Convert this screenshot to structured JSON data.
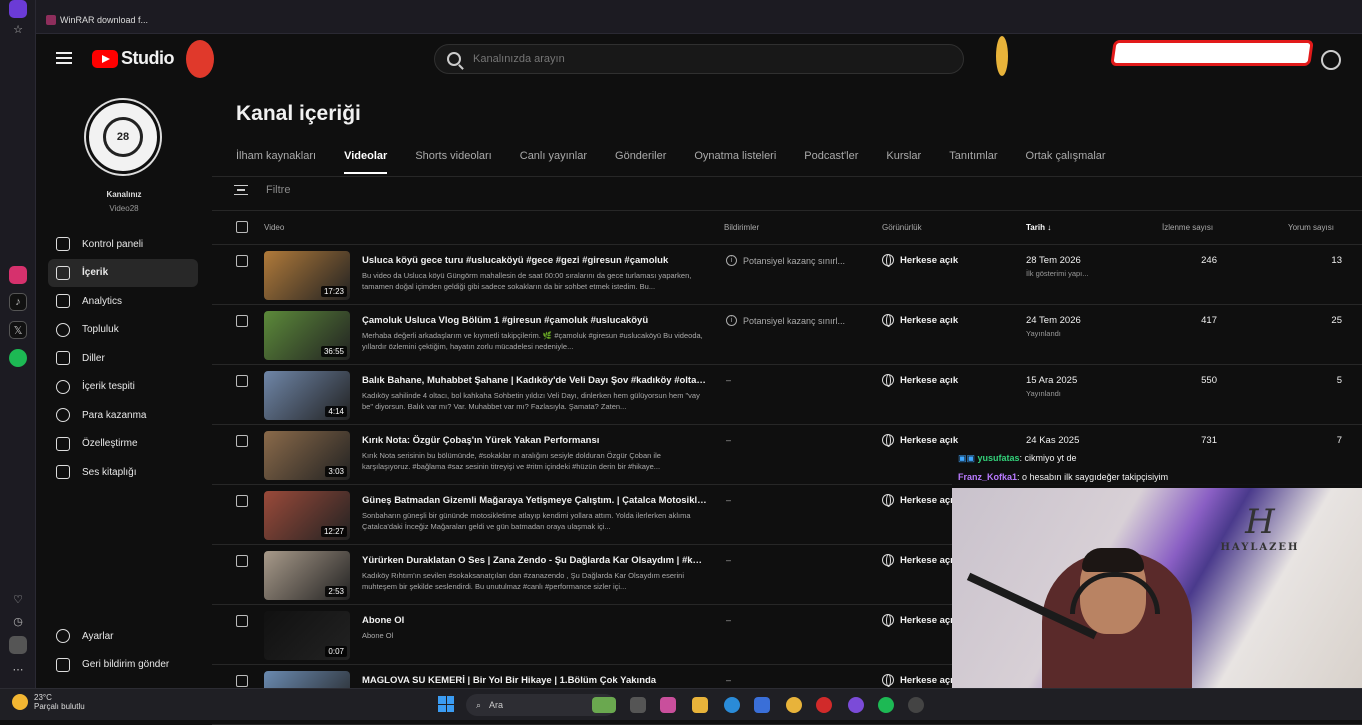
{
  "browser": {
    "tab_title": "WinRAR download f..."
  },
  "header": {
    "logo_text": "Studio",
    "search_placeholder": "Kanalınızda arayın"
  },
  "channel": {
    "name": "Kanalınız",
    "handle": "Video28",
    "avatar_text": "28"
  },
  "sidebar": {
    "items": [
      {
        "label": "Kontrol paneli",
        "icon": "dashboard-icon",
        "active": false
      },
      {
        "label": "İçerik",
        "icon": "content-icon",
        "active": true
      },
      {
        "label": "Analytics",
        "icon": "analytics-icon",
        "active": false
      },
      {
        "label": "Topluluk",
        "icon": "community-icon",
        "active": false
      },
      {
        "label": "Diller",
        "icon": "subtitles-icon",
        "active": false
      },
      {
        "label": "İçerik tespiti",
        "icon": "copyright-icon",
        "active": false
      },
      {
        "label": "Para kazanma",
        "icon": "monetization-icon",
        "active": false
      },
      {
        "label": "Özelleştirme",
        "icon": "customization-icon",
        "active": false
      },
      {
        "label": "Ses kitaplığı",
        "icon": "audio-library-icon",
        "active": false
      }
    ],
    "bottom": [
      {
        "label": "Ayarlar",
        "icon": "gear-icon"
      },
      {
        "label": "Geri bildirim gönder",
        "icon": "feedback-icon"
      }
    ]
  },
  "main": {
    "title": "Kanal içeriği",
    "tabs": [
      "İlham kaynakları",
      "Videolar",
      "Shorts videoları",
      "Canlı yayınlar",
      "Gönderiler",
      "Oynatma listeleri",
      "Podcast'ler",
      "Kurslar",
      "Tanıtımlar",
      "Ortak çalışmalar"
    ],
    "active_tab": "Videolar",
    "filter_placeholder": "Filtre",
    "columns": {
      "video": "Video",
      "restrictions": "Bildirimler",
      "visibility": "Görünürlük",
      "date": "Tarih",
      "views": "İzlenme sayısı",
      "comments": "Yorum sayısı"
    },
    "rows": [
      {
        "title": "Usluca köyü gece turu #uslucaköyü #gece #gezi #giresun #çamoluk",
        "desc": "Bu video da Usluca köyü Güngörm mahallesin de saat 00:00 sıralarını da gece turlaması yaparken, tamamen doğal içimden geldiği gibi sadece sokakların da bir sohbet etmek istedim. Bu...",
        "duration": "17:23",
        "restriction": "Potansiyel kazanç sınırl...",
        "visibility": "Herkese açık",
        "date": "28 Tem 2026",
        "date_sub": "İlk gösterimi yapı...",
        "views": "246",
        "comments": "13",
        "thumb": "#b07a3a"
      },
      {
        "title": "Çamoluk Usluca Vlog Bölüm 1 #giresun #çamoluk #uslucaköyü",
        "desc": "Merhaba değerli arkadaşlarım ve kıymetli takipçilerim. 🌿 #çamoluk #giresun #uslucaköyü Bu videoda, yıllardır özlemini çektiğim, hayatın zorlu mücadelesi nedeniyle...",
        "duration": "36:55",
        "restriction": "Potansiyel kazanç sınırl...",
        "visibility": "Herkese açık",
        "date": "24 Tem 2026",
        "date_sub": "Yayınlandı",
        "views": "417",
        "comments": "25",
        "thumb": "#5c8a3a"
      },
      {
        "title": "Balık Bahane, Muhabbet Şahane | Kadıköy'de Veli Dayı Şov #kadıköy #oltabal...",
        "desc": "Kadıköy sahilinde 4 oltacı, bol kahkaha Sohbetin yıldızı Veli Dayı, dinlerken hem gülüyorsun hem \"vay be\" diyorsun. Balık var mı? Var. Muhabbet var mı? Fazlasıyla. Şamata? Zaten...",
        "duration": "4:14",
        "restriction": "–",
        "visibility": "Herkese açık",
        "date": "15 Ara 2025",
        "date_sub": "Yayınlandı",
        "views": "550",
        "comments": "5",
        "thumb": "#6f86a8"
      },
      {
        "title": "Kırık Nota: Özgür Çobaş'ın Yürek Yakan Performansı",
        "desc": "Kırık Nota serisinin bu bölümünde, #sokaklar ın aralığını sesiyle dolduran Özgür Çoban ile karşılaşıyoruz. #bağlama #saz sesinin titreyişi ve #ritm içindeki #hüzün derin bir #hikaye...",
        "duration": "3:03",
        "restriction": "–",
        "visibility": "Herkese açık",
        "date": "24 Kas 2025",
        "date_sub": "",
        "views": "731",
        "comments": "7",
        "thumb": "#8a6a4a"
      },
      {
        "title": "Güneş Batmadan Gizemli Mağaraya Yetişmeye Çalıştım. | Çatalca Motosiklet...",
        "desc": "Sonbaharın güneşli bir gününde motosikletime atlayıp kendimi yollara attım. Yolda ilerlerken aklıma Çatalca'daki İnceğiz Mağaraları geldi ve gün batmadan oraya ulaşmak içi...",
        "duration": "12:27",
        "restriction": "–",
        "visibility": "Herkese açık",
        "date": "",
        "date_sub": "",
        "views": "",
        "comments": "",
        "thumb": "#9a4a3a"
      },
      {
        "title": "Yürürken Duraklatan O Ses | Zana Zendo - Şu Dağlarda Kar Olsaydım | #kadık...",
        "desc": "Kadıköy Rıhtım'ın sevilen #sokaksanatçıları dan #zanazendo , Şu Dağlarda Kar Olsaydım eserini muhteşem bir şekilde seslendirdi. Bu unutulmaz #canlı #performance sizler içi...",
        "duration": "2:53",
        "restriction": "–",
        "visibility": "Herkese açık",
        "date": "",
        "date_sub": "",
        "views": "",
        "comments": "",
        "thumb": "#a89a8a"
      },
      {
        "title": "Abone Ol",
        "desc": "Abone Ol",
        "duration": "0:07",
        "restriction": "–",
        "visibility": "Herkese açık",
        "date": "",
        "date_sub": "",
        "views": "",
        "comments": "",
        "thumb": "#111111"
      },
      {
        "title": "MAGLOVA SU KEMERİ | Bir Yol Bir Hikaye | 1.Bölüm Çok Yakında",
        "desc": "",
        "duration": "",
        "restriction": "–",
        "visibility": "Herkese açık",
        "date": "",
        "date_sub": "",
        "views": "",
        "comments": "",
        "thumb": "#6a8ab0"
      }
    ]
  },
  "chat": {
    "messages": [
      {
        "user": "yusufatas",
        "text": ": cikmiyo yt de"
      },
      {
        "user": "Franz_Kofka1",
        "text": ": o hesabın ilk saygıdeğer takipçisiyim"
      }
    ]
  },
  "webcam": {
    "sign_letter": "H",
    "sign_text": "HAYLAZEH"
  },
  "taskbar": {
    "temperature": "23°C",
    "weather": "Parçalı bulutlu",
    "search_label": "Ara"
  }
}
